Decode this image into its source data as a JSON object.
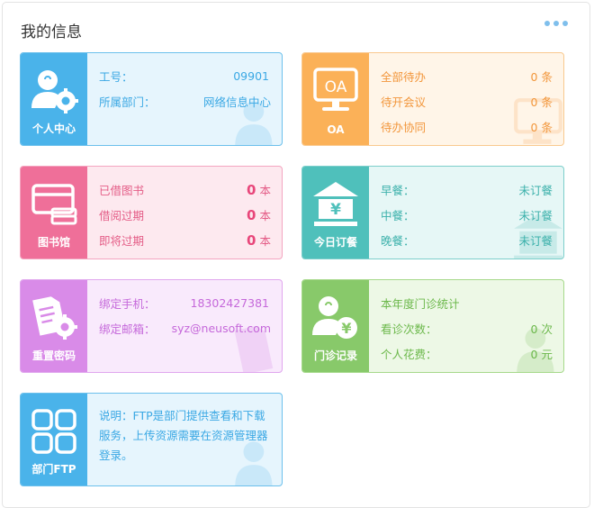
{
  "header": {
    "title": "我的信息"
  },
  "cards": {
    "personal": {
      "label": "个人中心",
      "rows": [
        {
          "key": "工号：",
          "value": "09901"
        },
        {
          "key": "所属部门：",
          "value": "网络信息中心"
        }
      ]
    },
    "oa": {
      "label": "OA",
      "icon_text": "OA",
      "rows": [
        {
          "key": "全部待办",
          "value": "0",
          "unit": "条"
        },
        {
          "key": "待开会议",
          "value": "0",
          "unit": "条"
        },
        {
          "key": "待办协同",
          "value": "0",
          "unit": "条"
        }
      ]
    },
    "library": {
      "label": "图书馆",
      "rows": [
        {
          "key": "已借图书",
          "value": "0",
          "unit": "本"
        },
        {
          "key": "借阅过期",
          "value": "0",
          "unit": "本"
        },
        {
          "key": "即将过期",
          "value": "0",
          "unit": "本"
        }
      ]
    },
    "meal": {
      "label": "今日订餐",
      "icon_text": "¥",
      "rows": [
        {
          "key": "早餐：",
          "value": "未订餐"
        },
        {
          "key": "中餐：",
          "value": "未订餐"
        },
        {
          "key": "晚餐：",
          "value": "未订餐"
        }
      ]
    },
    "password": {
      "label": "重置密码",
      "rows": [
        {
          "key": "绑定手机：",
          "value": "18302427381"
        },
        {
          "key": "绑定邮箱：",
          "value": "syz@neusoft.com"
        }
      ]
    },
    "clinic": {
      "label": "门诊记录",
      "icon_text": "¥",
      "heading": "本年度门诊统计",
      "rows": [
        {
          "key": "看诊次数：",
          "value": "0",
          "unit": "次"
        },
        {
          "key": "个人花费：",
          "value": "0",
          "unit": "元"
        }
      ]
    },
    "ftp": {
      "label": "部门FTP",
      "description": "说明：FTP是部门提供查看和下载服务，上传资源需要在资源管理器登录。"
    }
  }
}
